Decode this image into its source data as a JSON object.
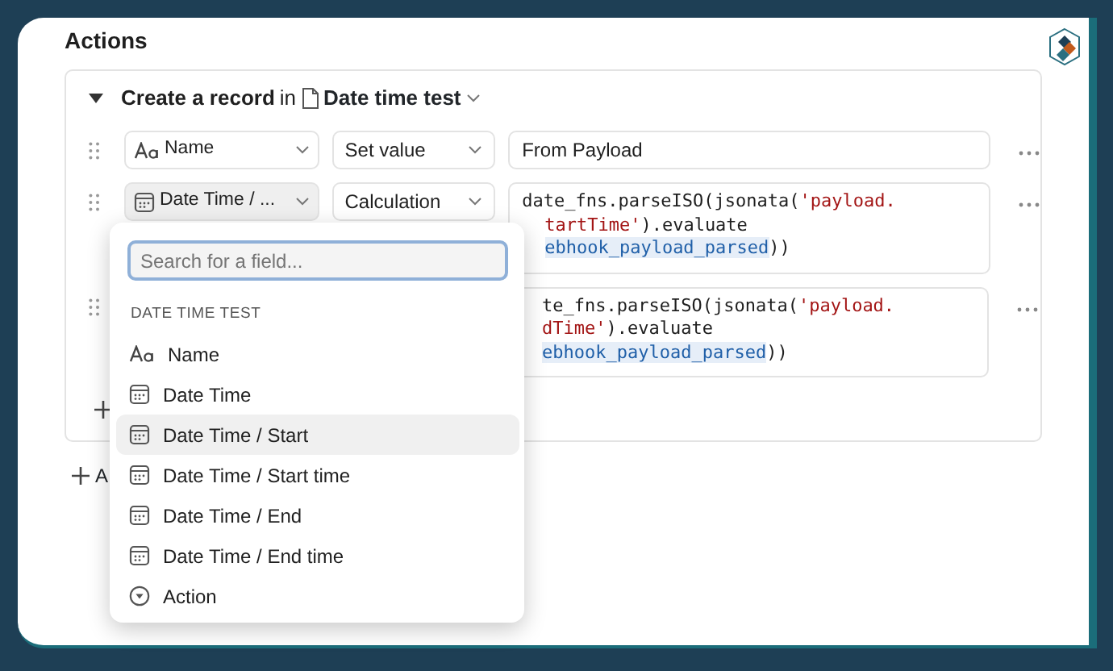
{
  "section_title": "Actions",
  "action": {
    "expanded": true,
    "prefix": "Create a record",
    "joiner": "in",
    "table": "Date time test"
  },
  "rows": [
    {
      "kind": "text",
      "field": {
        "kind": "text",
        "label": "Name",
        "active": false
      },
      "operation": "Set value",
      "value": "From Payload"
    },
    {
      "kind": "code",
      "field": {
        "kind": "date",
        "label": "Date Time / ...",
        "active": true
      },
      "operation": "Calculation",
      "code": [
        [
          {
            "kind": "plain",
            "text": "date_fns.parseISO(jsonata("
          },
          {
            "kind": "string",
            "text": "'payload."
          }
        ],
        [
          {
            "kind": "string",
            "text": "tartTime'",
            "partly_hidden": true
          },
          {
            "kind": "plain",
            "text": ").evaluate"
          }
        ],
        [
          {
            "kind": "variable",
            "text": "ebhook_payload_parsed",
            "partly_hidden": true
          },
          {
            "kind": "plain",
            "text": "))"
          }
        ]
      ]
    },
    {
      "kind": "code",
      "code": [
        [
          {
            "kind": "plain",
            "text": "te_fns.parseISO(jsonata(",
            "partly_hidden": true
          },
          {
            "kind": "string",
            "text": "'payload."
          }
        ],
        [
          {
            "kind": "string",
            "text": "dTime'",
            "partly_hidden": true
          },
          {
            "kind": "plain",
            "text": ").evaluate"
          }
        ],
        [
          {
            "kind": "variable",
            "text": "ebhook_payload_parsed",
            "partly_hidden": true
          },
          {
            "kind": "plain",
            "text": "))"
          }
        ]
      ]
    }
  ],
  "add_action_label": "A",
  "dropdown": {
    "search": {
      "placeholder": "Search for a field..."
    },
    "group": "DATE TIME TEST",
    "items": [
      {
        "kind": "text",
        "label": "Name",
        "selected": false
      },
      {
        "kind": "date",
        "label": "Date Time",
        "selected": false
      },
      {
        "kind": "date",
        "label": "Date Time / Start",
        "selected": true
      },
      {
        "kind": "date",
        "label": "Date Time / Start time",
        "selected": false
      },
      {
        "kind": "date",
        "label": "Date Time / End",
        "selected": false
      },
      {
        "kind": "date",
        "label": "Date Time / End time",
        "selected": false
      },
      {
        "kind": "select",
        "label": "Action",
        "selected": false
      }
    ]
  }
}
